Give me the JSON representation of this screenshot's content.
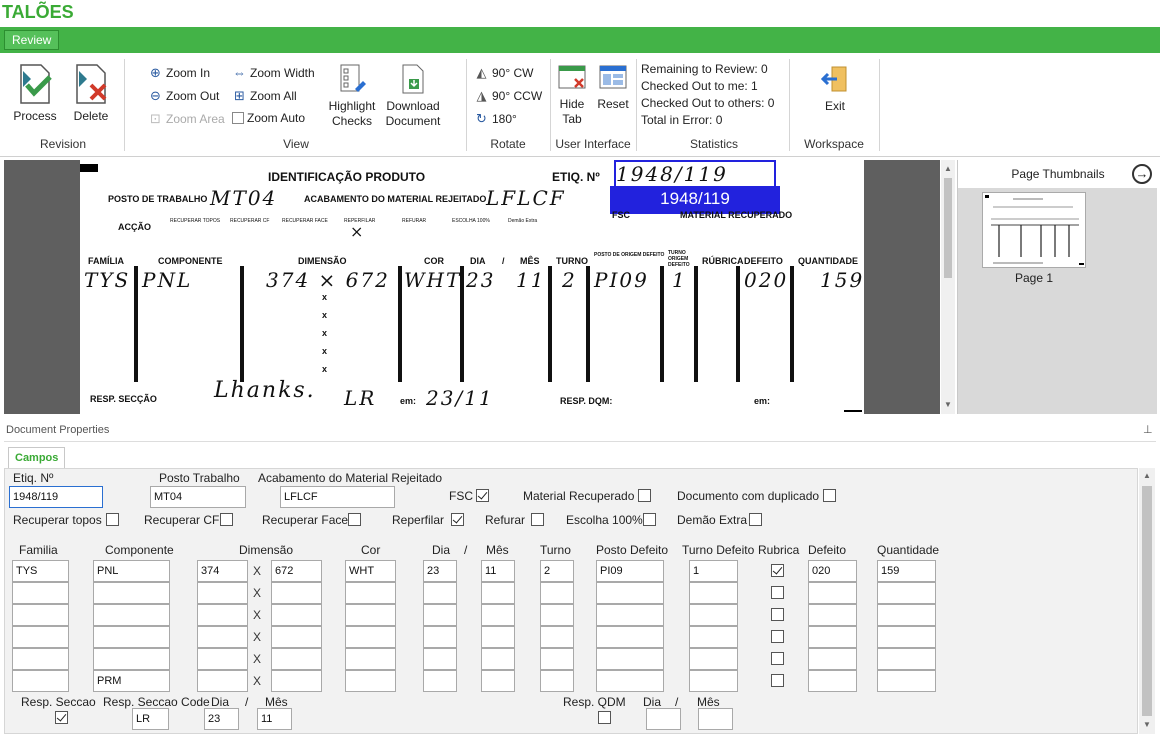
{
  "app": {
    "title": "TALÕES"
  },
  "menu": {
    "tab": "Review"
  },
  "ribbon": {
    "revision": {
      "label": "Revision",
      "process": "Process",
      "delete": "Delete"
    },
    "view": {
      "label": "View",
      "zoom_in": "Zoom In",
      "zoom_out": "Zoom Out",
      "zoom_area": "Zoom Area",
      "zoom_width": "Zoom Width",
      "zoom_all": "Zoom All",
      "zoom_auto": "Zoom Auto",
      "highlight_checks_1": "Highlight",
      "highlight_checks_2": "Checks",
      "download_1": "Download",
      "download_2": "Document"
    },
    "rotate": {
      "label": "Rotate",
      "cw": "90° CW",
      "ccw": "90° CCW",
      "r180": "180°"
    },
    "ui": {
      "label": "User Interface",
      "hide_1": "Hide",
      "hide_2": "Tab",
      "reset": "Reset"
    },
    "statistics": {
      "label": "Statistics",
      "remaining": "Remaining to Review: 0",
      "checked_me": "Checked Out to me: 1",
      "checked_others": "Checked Out to others: 0",
      "in_error": "Total in Error: 0"
    },
    "workspace": {
      "label": "Workspace",
      "exit": "Exit"
    }
  },
  "document_image": {
    "title": "IDENTIFICAÇÃO PRODUTO",
    "etiq_label": "ETIQ. Nº",
    "etiq_hw": "1948/119",
    "etiq_overlay": "1948/119",
    "posto_label": "POSTO DE TRABALHO",
    "posto_hw": "MT04",
    "acab_label": "ACABAMENTO DO MATERIAL REJEITADO",
    "acab_hw": "LFLCF",
    "fsc": "FSC",
    "mat_rec": "MATERIAL RECUPERADO",
    "accao": "ACÇÃO",
    "small_headers": [
      "RECUPERAR TOPOS",
      "RECUPERAR CF",
      "RECUPERAR FACE",
      "REPERFILAR",
      "REFURAR",
      "ESCOLHA 100%",
      "Demão Extra"
    ],
    "cols": [
      "FAMÍLIA",
      "COMPONENTE",
      "DIMENSÃO",
      "COR",
      "DIA",
      "/",
      "MÊS",
      "TURNO",
      "POSTO DE ORIGEM DEFEITO",
      "TURNO ORIGEM DEFEITO",
      "RÚBRICA",
      "DEFEITO",
      "QUANTIDADE"
    ],
    "row_hw": [
      "TYS",
      "PNL",
      "374 × 672",
      "WHT",
      "23",
      "11",
      "2",
      "PI09",
      "1",
      "020",
      "159"
    ],
    "resp_seccao": "RESP. SECÇÃO",
    "resp_hw": "LR",
    "em": "em:",
    "em_hw": "23/11",
    "resp_dqm": "RESP. DQM:",
    "em2": "em:"
  },
  "thumbnails": {
    "header": "Page Thumbnails",
    "page": "Page 1"
  },
  "properties": {
    "title": "Document Properties",
    "tab": "Campos",
    "etiq": {
      "label": "Etiq. Nº",
      "value": "1948/119"
    },
    "posto": {
      "label": "Posto Trabalho",
      "value": "MT04"
    },
    "acab": {
      "label": "Acabamento do Material Rejeitado",
      "value": "LFLCF"
    },
    "fsc": {
      "label": "FSC",
      "checked": true
    },
    "mat_rec": {
      "label": "Material Recuperado",
      "checked": false
    },
    "doc_dup": {
      "label": "Documento com duplicado",
      "checked": false
    },
    "rec_topos": {
      "label": "Recuperar topos",
      "checked": false
    },
    "rec_cf": {
      "label": "Recuperar CF",
      "checked": false
    },
    "rec_face": {
      "label": "Recuperar Face",
      "checked": false
    },
    "reperfilar": {
      "label": "Reperfilar",
      "checked": true
    },
    "refurar": {
      "label": "Refurar",
      "checked": false
    },
    "escolha": {
      "label": "Escolha 100%",
      "checked": false
    },
    "demao": {
      "label": "Demão Extra",
      "checked": false
    },
    "headers": {
      "familia": "Familia",
      "componente": "Componente",
      "dimensao": "Dimensão",
      "cor": "Cor",
      "dia": "Dia",
      "slash": "/",
      "mes": "Mês",
      "turno": "Turno",
      "posto_defeito": "Posto Defeito",
      "turno_defeito": "Turno Defeito",
      "rubrica": "Rubrica",
      "defeito": "Defeito",
      "quantidade": "Quantidade"
    },
    "x": "X",
    "rows": [
      {
        "familia": "TYS",
        "componente": "PNL",
        "dim1": "374",
        "dim2": "672",
        "cor": "WHT",
        "dia": "23",
        "mes": "11",
        "turno": "2",
        "posto": "PI09",
        "turno_def": "1",
        "rubrica": true,
        "defeito": "020",
        "qtd": "159"
      },
      {
        "familia": "",
        "componente": "",
        "dim1": "",
        "dim2": "",
        "cor": "",
        "dia": "",
        "mes": "",
        "turno": "",
        "posto": "",
        "turno_def": "",
        "rubrica": false,
        "defeito": "",
        "qtd": ""
      },
      {
        "familia": "",
        "componente": "",
        "dim1": "",
        "dim2": "",
        "cor": "",
        "dia": "",
        "mes": "",
        "turno": "",
        "posto": "",
        "turno_def": "",
        "rubrica": false,
        "defeito": "",
        "qtd": ""
      },
      {
        "familia": "",
        "componente": "",
        "dim1": "",
        "dim2": "",
        "cor": "",
        "dia": "",
        "mes": "",
        "turno": "",
        "posto": "",
        "turno_def": "",
        "rubrica": false,
        "defeito": "",
        "qtd": ""
      },
      {
        "familia": "",
        "componente": "",
        "dim1": "",
        "dim2": "",
        "cor": "",
        "dia": "",
        "mes": "",
        "turno": "",
        "posto": "",
        "turno_def": "",
        "rubrica": false,
        "defeito": "",
        "qtd": ""
      },
      {
        "familia": "",
        "componente": "PRM",
        "dim1": "",
        "dim2": "",
        "cor": "",
        "dia": "",
        "mes": "",
        "turno": "",
        "posto": "",
        "turno_def": "",
        "rubrica": false,
        "defeito": "",
        "qtd": ""
      }
    ],
    "resp_seccao": {
      "label": "Resp. Seccao",
      "checked": true
    },
    "resp_code": {
      "label": "Resp. Seccao Code",
      "value": "LR"
    },
    "resp_dia": {
      "label": "Dia",
      "value": "23"
    },
    "resp_slash": "/",
    "resp_mes": {
      "label": "Mês",
      "value": "11"
    },
    "resp_qdm": {
      "label": "Resp. QDM",
      "checked": false
    },
    "qdm_dia": {
      "label": "Dia",
      "value": ""
    },
    "qdm_slash": "/",
    "qdm_mes": {
      "label": "Mês",
      "value": ""
    }
  },
  "colors": {
    "accent": "#43b347",
    "title": "#3aaa35",
    "overlay": "#2222dd"
  }
}
